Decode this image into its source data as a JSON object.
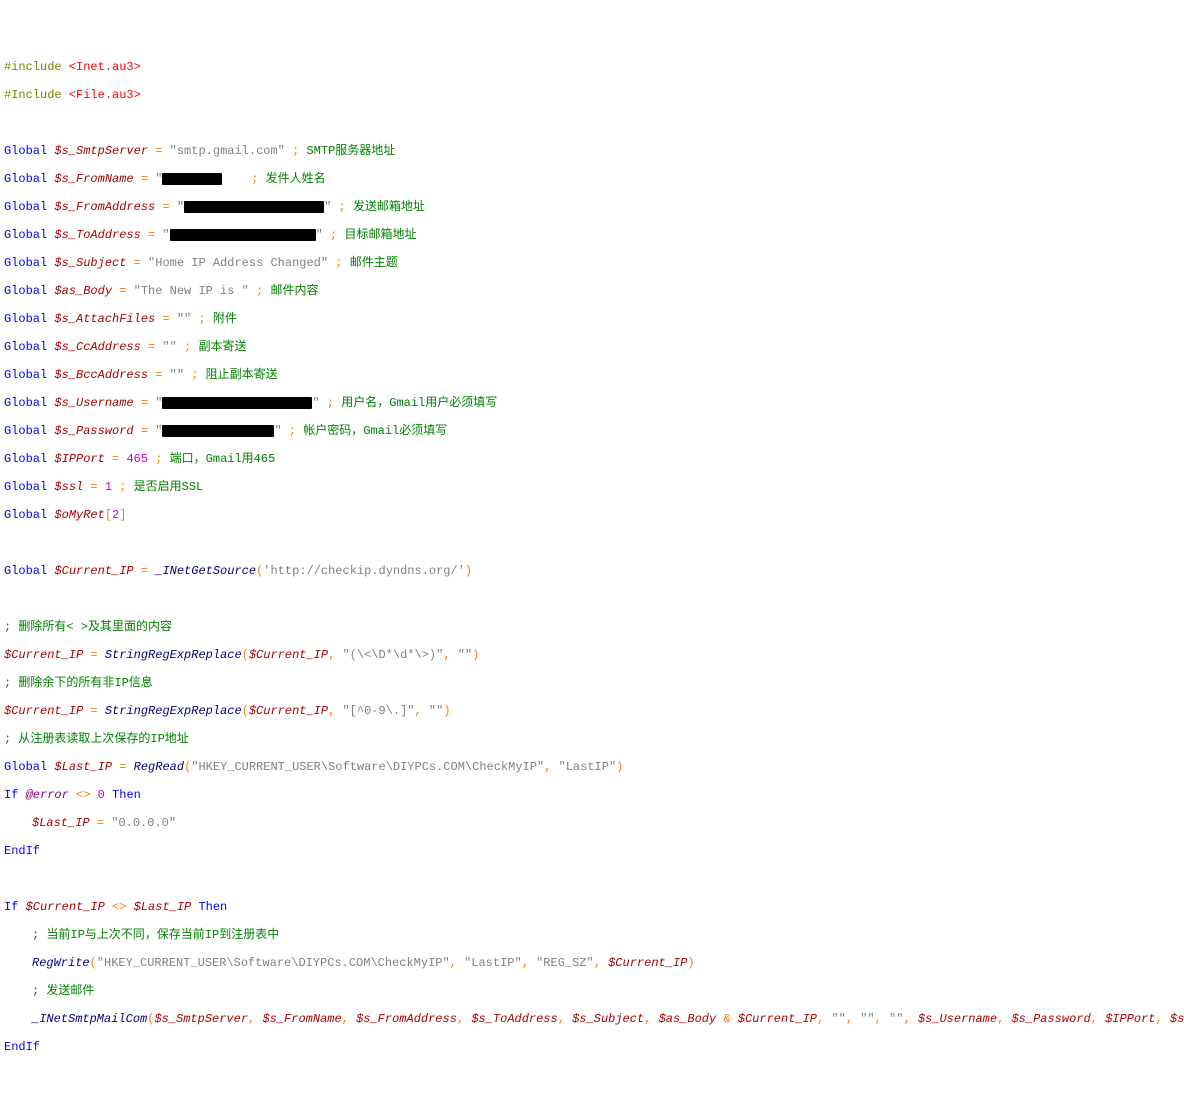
{
  "lines": {
    "inc1_dir": "#include",
    "inc1_file": "<Inet.au3>",
    "inc2_dir": "#Include",
    "inc2_file": "<File.au3>",
    "kw_global": "Global",
    "kw_if": "If",
    "kw_then": "Then",
    "kw_endif": "EndIf",
    "eq": " = ",
    "amp": " & ",
    "ne": " <> ",
    "sc": " ; ",
    "lb": "[",
    "rb": "]",
    "comma": ", ",
    "lp": "(",
    "rp": ")",
    "q_empty": "\"\"",
    "smtp_var": "$s_SmtpServer",
    "smtp_val": "\"smtp.gmail.com\"",
    "smtp_cmt": "SMTP服务器地址",
    "from_var": "$s_FromName",
    "from_q": "\"",
    "from_cmt": "发件人姓名",
    "fromaddr_var": "$s_FromAddress",
    "fromaddr_cmt": "发送邮箱地址",
    "toaddr_var": "$s_ToAddress",
    "toaddr_cmt": "目标邮箱地址",
    "subj_var": "$s_Subject",
    "subj_val": "\"Home IP Address Changed\"",
    "subj_cmt": "邮件主题",
    "body_var": "$as_Body",
    "body_val": "\"The New IP is \"",
    "body_cmt": "邮件内容",
    "attach_var": "$s_AttachFiles",
    "attach_cmt": "附件",
    "cc_var": "$s_CcAddress",
    "cc_cmt": "副本寄送",
    "bcc_var": "$s_BccAddress",
    "bcc_cmt": "阻止副本寄送",
    "user_var": "$s_Username",
    "user_cmt": "用户名，Gmail用户必须填写",
    "pass_var": "$s_Password",
    "pass_cmt": "帐户密码，Gmail必须填写",
    "port_var": "$IPPort",
    "port_val": "465",
    "port_cmt": "端口，Gmail用465",
    "ssl_var": "$ssl",
    "ssl_val": "1",
    "ssl_cmt": "是否启用SSL",
    "omyret_var": "$oMyRet",
    "omyret_idx": "2",
    "cur_var": "$Current_IP",
    "inet_fn": "_INetGetSource",
    "inet_arg": "'http://checkip.dyndns.org/'",
    "cmt_strip": "; 删除所有< >及其里面的内容",
    "strrep_fn": "StringRegExpReplace",
    "regex1": "\"(\\<\\D*\\d*\\>)\"",
    "cmt_strip2": "; 删除余下的所有非IP信息",
    "regex2": "\"[^0-9\\.]\"",
    "cmt_reg": "; 从注册表读取上次保存的IP地址",
    "last_var": "$Last_IP",
    "regread_fn": "RegRead",
    "regkey": "\"HKEY_CURRENT_USER\\Software\\DIYPCs.COM\\CheckMyIP\"",
    "lastip_str": "\"LastIP\"",
    "err_mac": "@error",
    "zero": "0",
    "zeroip": "\"0.0.0.0\"",
    "cmt_diff": "; 当前IP与上次不同，保存当前IP到注册表中",
    "regwrite_fn": "RegWrite",
    "regsz": "\"REG_SZ\"",
    "cmt_send": "; 发送邮件",
    "mail_fn": "_INetSmtpMailCom"
  }
}
